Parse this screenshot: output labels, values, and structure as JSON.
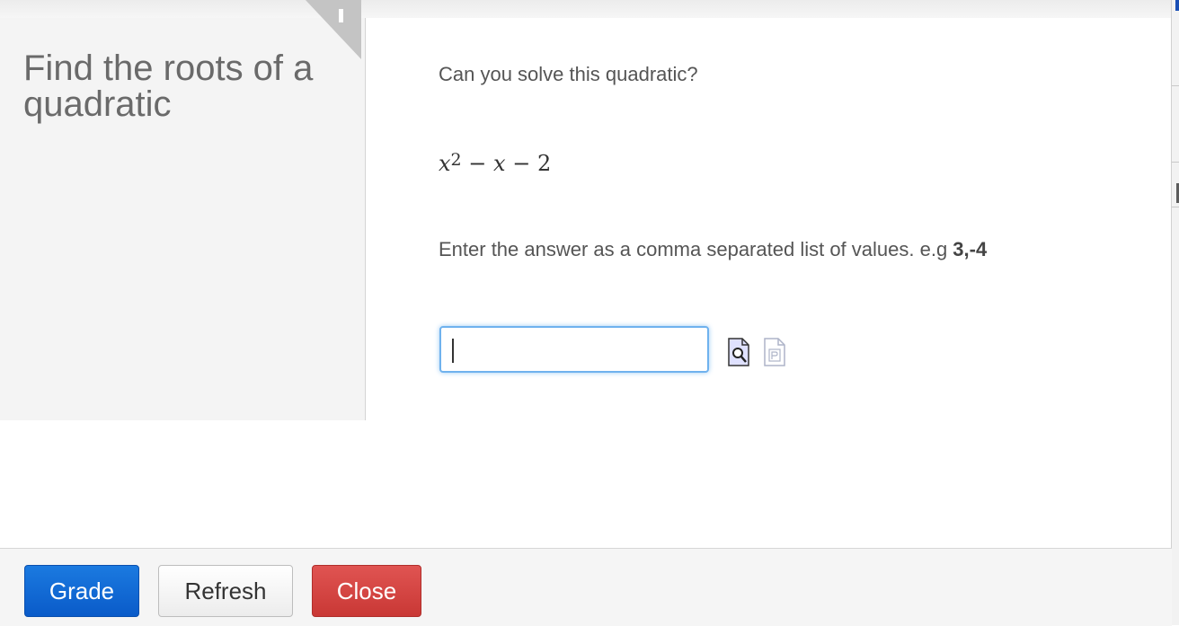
{
  "sidebar": {
    "title": "Find the roots of a quadratic",
    "collapse_label": "-"
  },
  "question": {
    "prompt": "Can you solve this quadratic?",
    "equation": {
      "base": "x",
      "exponent": "2",
      "rest_op1": " − ",
      "rest_var": "x",
      "rest_op2": " − ",
      "rest_const": "2"
    },
    "instruction_prefix": "Enter the answer as a comma separated list of values. e.g ",
    "instruction_example": "3,-4"
  },
  "answer": {
    "value": "",
    "preview_icon": "preview-icon",
    "paste_icon": "paste-icon"
  },
  "footer": {
    "grade_label": "Grade",
    "refresh_label": "Refresh",
    "close_label": "Close"
  },
  "colors": {
    "grade": "#0a5bc9",
    "close": "#c93835",
    "input_focus": "#6fb2ee"
  }
}
